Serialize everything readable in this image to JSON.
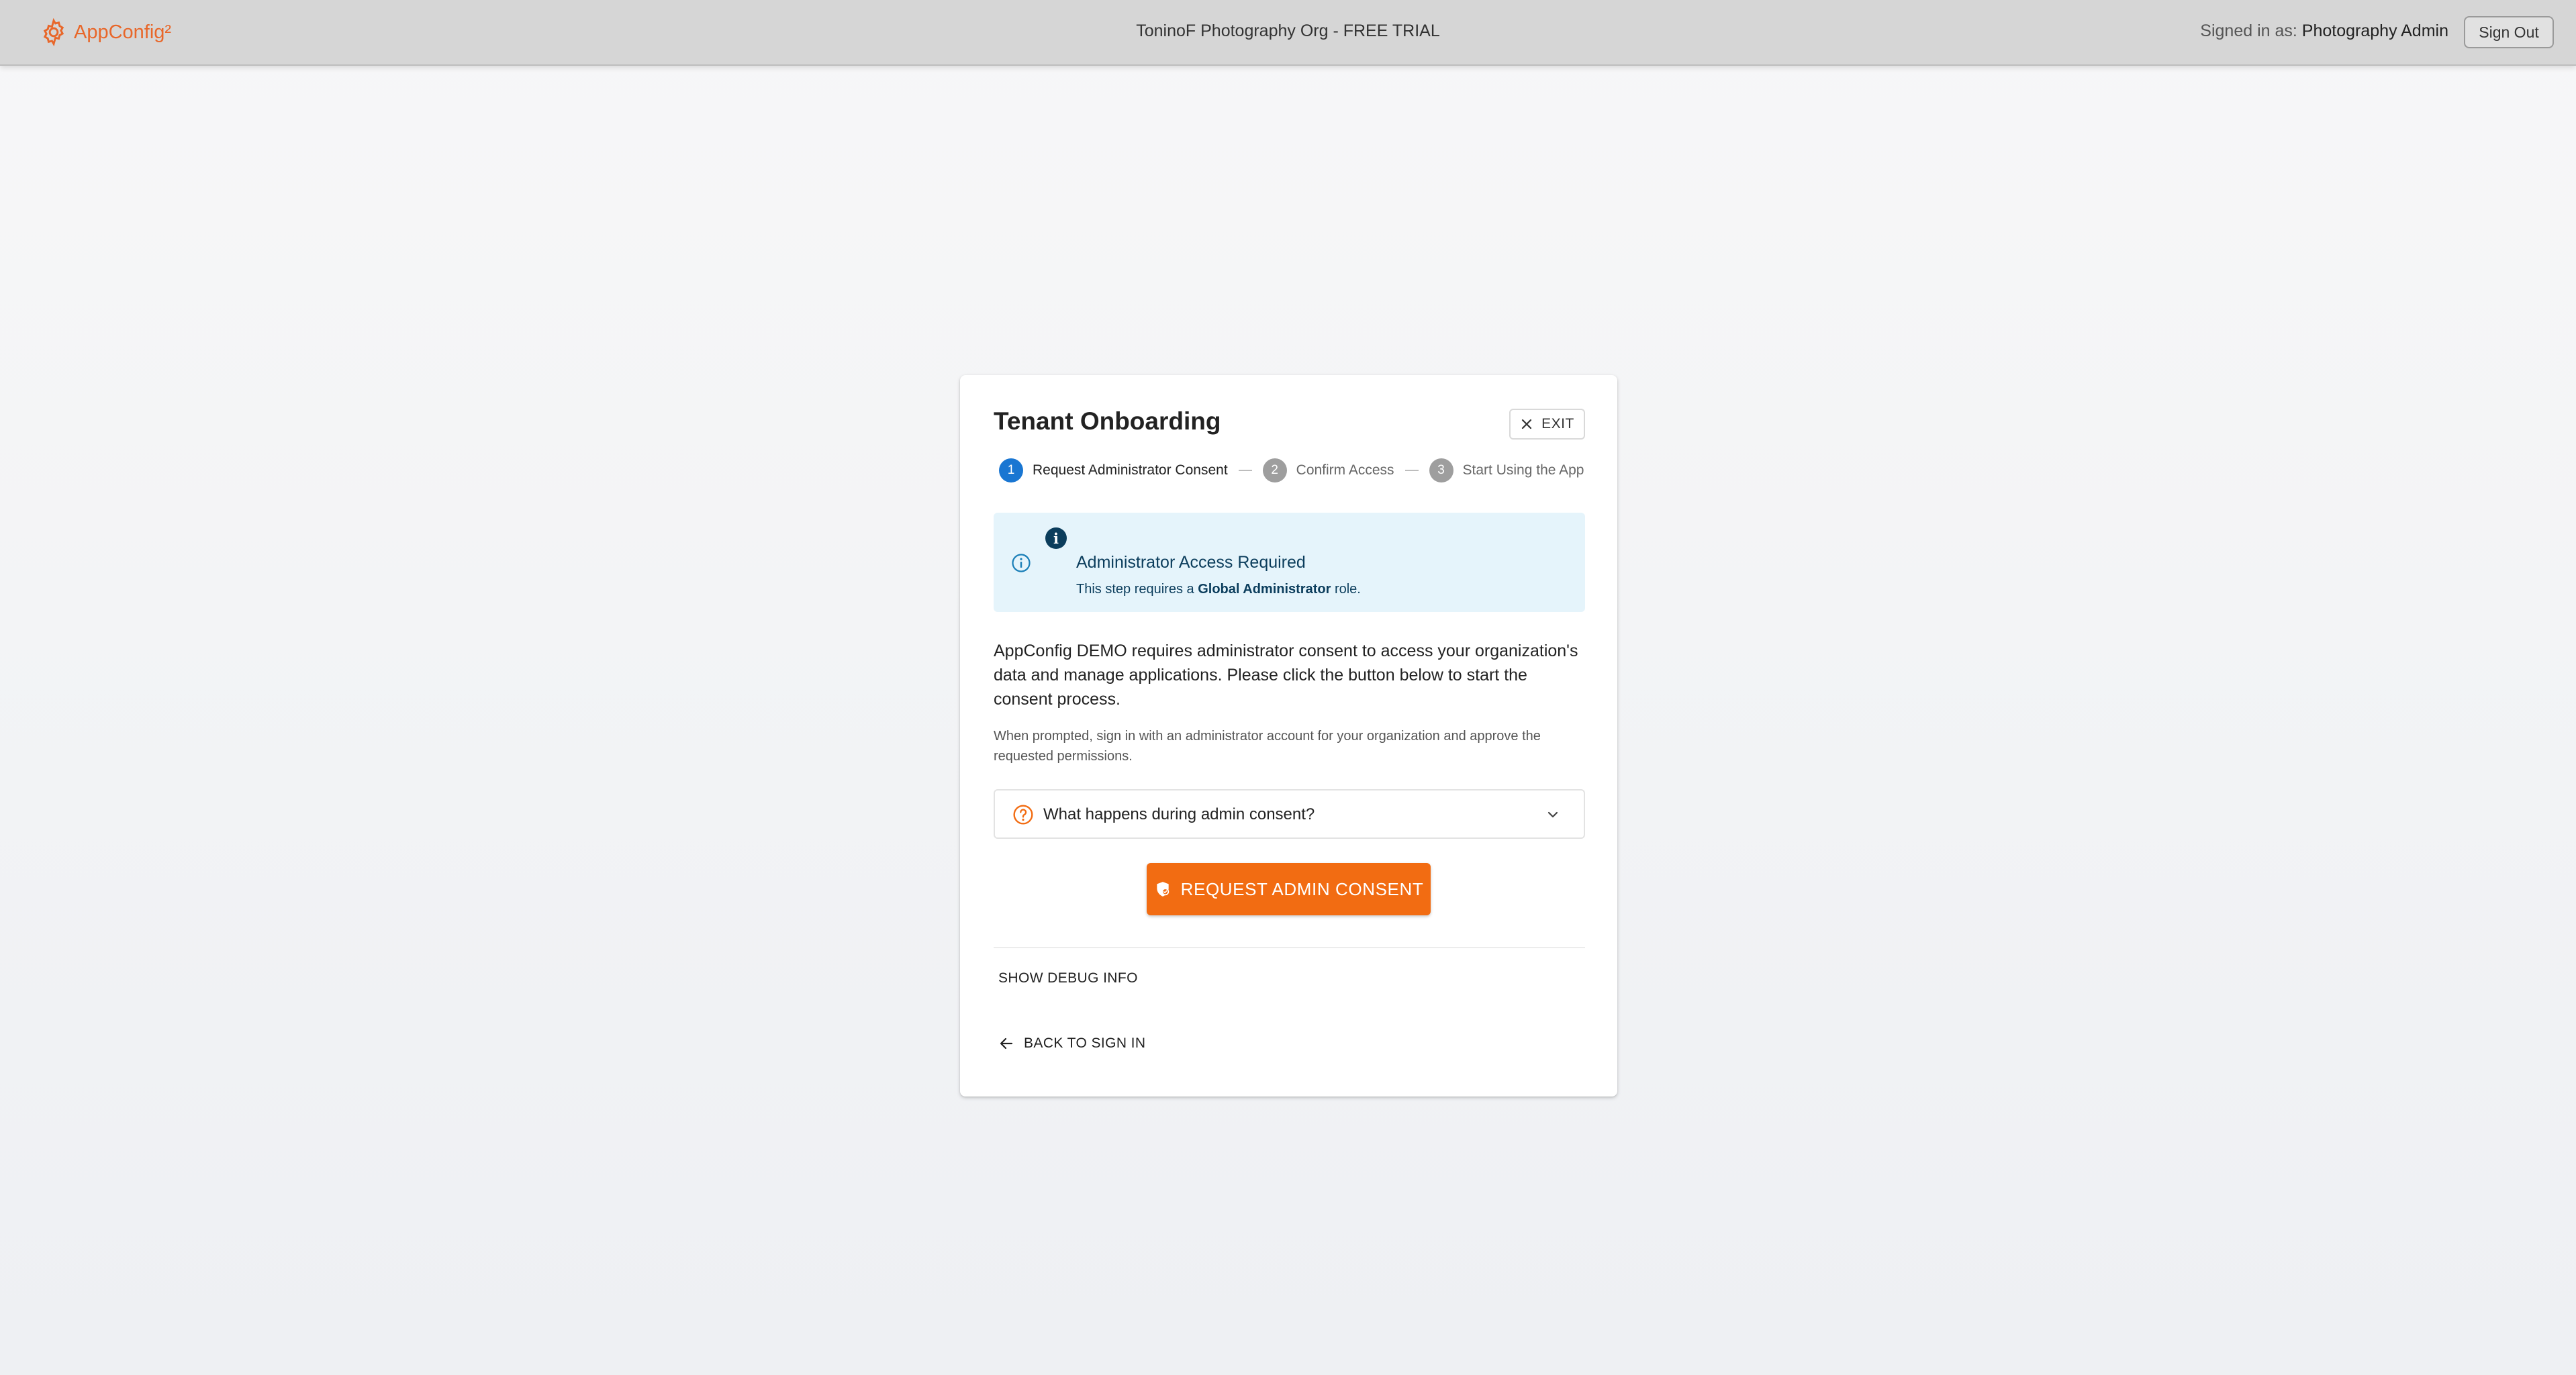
{
  "header": {
    "brand_name": "AppConfig²",
    "org_title": "ToninoF Photography Org - FREE TRIAL",
    "signed_in_prefix": "Signed in as:",
    "signed_in_user": "Photography Admin",
    "sign_out_label": "Sign Out"
  },
  "card": {
    "title": "Tenant Onboarding",
    "exit_label": "EXIT",
    "steps": [
      {
        "number": "1",
        "label": "Request Administrator Consent",
        "state": "active"
      },
      {
        "number": "2",
        "label": "Confirm Access",
        "state": "inactive"
      },
      {
        "number": "3",
        "label": "Start Using the App",
        "state": "inactive"
      }
    ],
    "alert": {
      "badge": "i",
      "title": "Administrator Access Required",
      "desc_prefix": "This step requires a",
      "desc_strong": "Global Administrator",
      "desc_suffix": "role."
    },
    "body_text": "AppConfig DEMO requires administrator consent to access your organization's data and manage applications. Please click the button below to start the consent process.",
    "hint_text": "When prompted, sign in with an administrator account for your organization and approve the requested permissions.",
    "accordion_label": "What happens during admin consent?",
    "primary_button_label": "REQUEST ADMIN CONSENT",
    "debug_label": "SHOW DEBUG INFO",
    "back_label": "BACK TO SIGN IN"
  },
  "colors": {
    "brand": "#e8672a",
    "primary": "#f26c12",
    "step_active": "#1976d2",
    "alert_bg": "#e5f4fb",
    "alert_text": "#0b3d5c"
  },
  "icons": [
    "gear-logo-icon",
    "close-icon",
    "info-icon",
    "help-circle-icon",
    "chevron-down-icon",
    "shield-icon",
    "arrow-left-icon"
  ]
}
